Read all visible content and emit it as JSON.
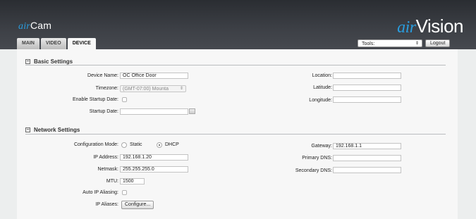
{
  "brand": {
    "left_prefix": "air",
    "left_name": "Cam",
    "right_prefix": "air",
    "right_name": "Vision"
  },
  "tabs": [
    {
      "label": "MAIN"
    },
    {
      "label": "VIDEO"
    },
    {
      "label": "DEVICE",
      "active": true
    }
  ],
  "header": {
    "tools_label": "Tools:",
    "logout_label": "Logout"
  },
  "basic": {
    "title": "Basic Settings",
    "device_name_label": "Device Name:",
    "device_name_value": "OC Office Door",
    "timezone_label": "Timezone:",
    "timezone_value": "(GMT-07:00) Mounta",
    "enable_startup_label": "Enable Startup Date:",
    "enable_startup_checked": false,
    "startup_date_label": "Startup Date:",
    "startup_date_value": "",
    "location_label": "Location:",
    "location_value": "",
    "latitude_label": "Latitude:",
    "latitude_value": "",
    "longitude_label": "Longitude:",
    "longitude_value": ""
  },
  "network": {
    "title": "Network Settings",
    "config_mode_label": "Configuration Mode:",
    "static_label": "Static",
    "dhcp_label": "DHCP",
    "selected_mode": "DHCP",
    "ip_label": "IP Address:",
    "ip_value": "192.168.1.20",
    "netmask_label": "Netmask:",
    "netmask_value": "255.255.255.0",
    "mtu_label": "MTU:",
    "mtu_value": "1500",
    "alias_label": "Auto IP Aliasing:",
    "alias_checked": false,
    "ip_aliases_label": "IP Aliases:",
    "configure_label": "Configure...",
    "gateway_label": "Gateway:",
    "gateway_value": "192.168.1.1",
    "dns1_label": "Primary DNS:",
    "dns1_value": "",
    "dns2_label": "Secondary DNS:",
    "dns2_value": ""
  },
  "colors": {
    "accent": "#2a9cdd",
    "header_bg": "#3d4046",
    "panel_bg": "#f7f7f7"
  }
}
